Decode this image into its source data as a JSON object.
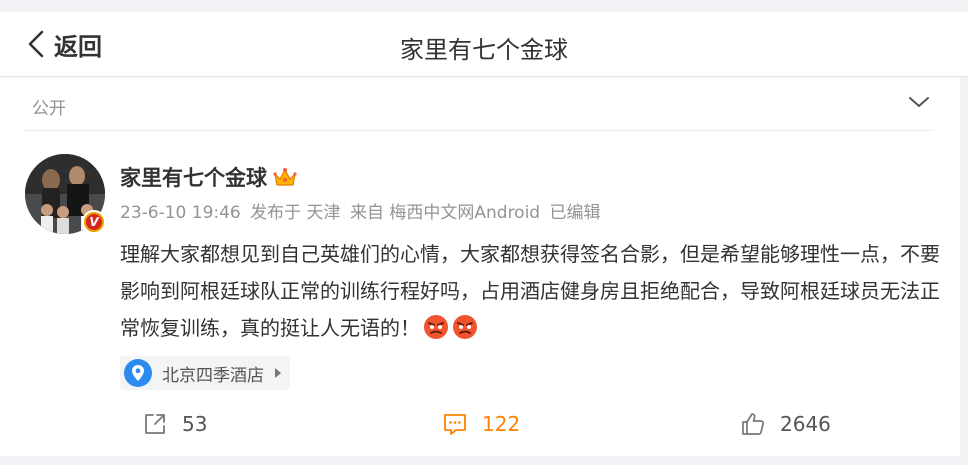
{
  "header": {
    "back_label": "返回",
    "title": "家里有七个金球"
  },
  "post": {
    "visibility": "公开",
    "author": "家里有七个金球",
    "meta": {
      "time": "23-6-10 19:46",
      "posted_from": "发布于 天津",
      "source": "来自 梅西中文网Android",
      "edited": "已编辑"
    },
    "content": "理解大家都想见到自己英雄们的心情，大家都想获得签名合影，但是希望能够理性一点，不要影响到阿根廷球队正常的训练行程好吗，占用酒店健身房且拒绝配合，导致阿根廷球员无法正常恢复训练，真的挺让人无语的！",
    "emojis": [
      "angry-emoji",
      "angry-emoji"
    ],
    "location": "北京四季酒店",
    "badge_letter": "V"
  },
  "actions": {
    "shares": "53",
    "comments": "122",
    "likes": "2646"
  },
  "colors": {
    "accent": "#ff8200",
    "location_pin": "#2b8cee",
    "muted": "#939393"
  }
}
